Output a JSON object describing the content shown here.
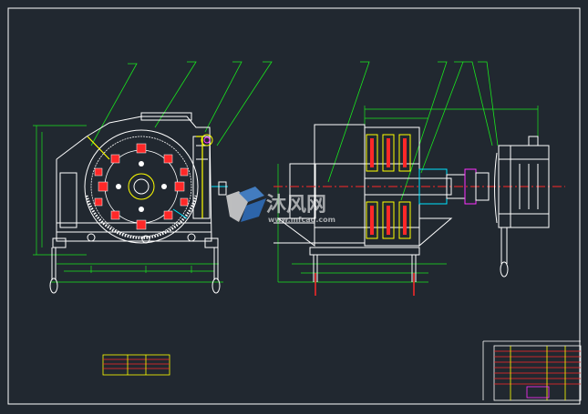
{
  "drawing": {
    "background": "#212830",
    "border_color": "#ffffff",
    "colors": {
      "outline": "#ffffff",
      "dimension": "#19e61e",
      "red": "#ff2828",
      "yellow": "#ffff00",
      "cyan": "#00e5ff",
      "magenta": "#ff30ff"
    }
  },
  "watermark": {
    "logo_icon": "mfcad-logo-icon",
    "text": "沐风网",
    "url": "www.mfcad.com"
  }
}
